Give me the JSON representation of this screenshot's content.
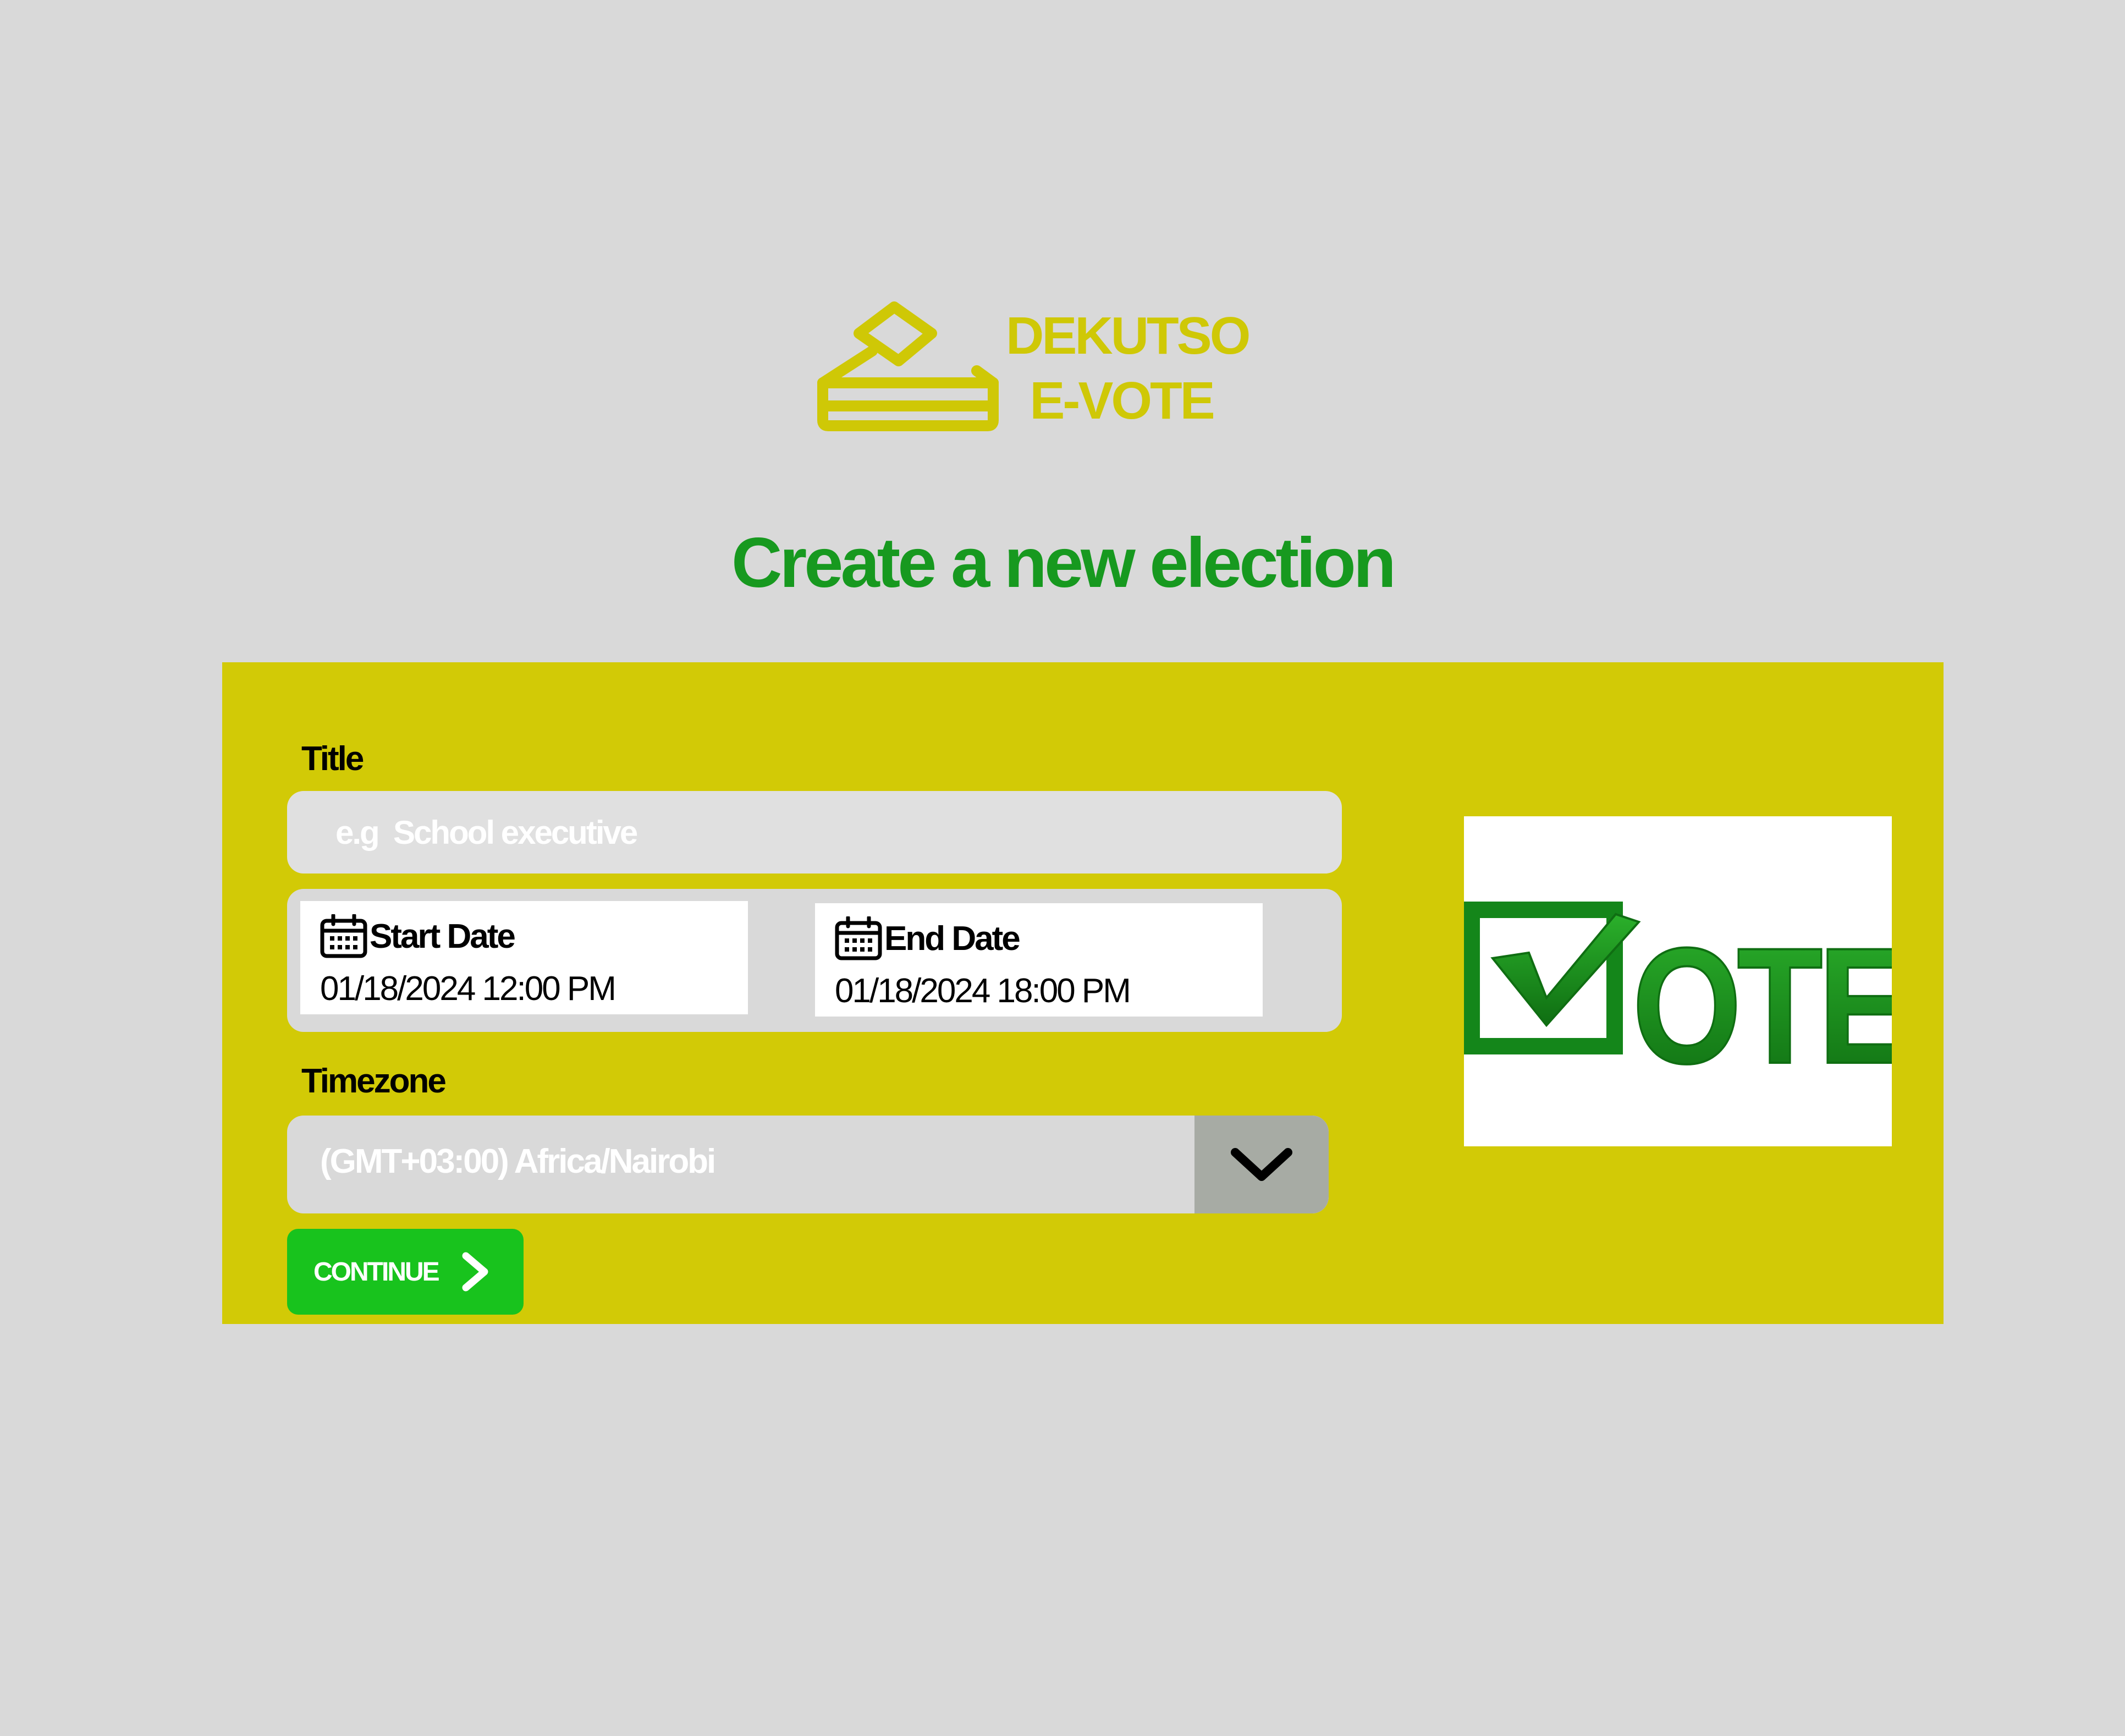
{
  "brand": {
    "logo_icon": "ballot-box-icon",
    "name_line1": "DEKUTSO",
    "name_line2": "E-VOTE",
    "color": "#cfc806"
  },
  "page": {
    "title": "Create a new election",
    "title_color": "#17991f",
    "background": "#d9d9d9"
  },
  "form": {
    "panel_color": "#d2ca06",
    "title_label": "Title",
    "title_placeholder": "e.g  School executive",
    "title_value": "",
    "start_date": {
      "label": "Start Date",
      "icon": "calendar-icon",
      "value": "01/18/2024 12:00 PM"
    },
    "end_date": {
      "label": "End Date",
      "icon": "calendar-icon",
      "value": "01/18/2024 18:00 PM"
    },
    "timezone_label": "Timezone",
    "timezone_value": "(GMT+03:00)  Africa/Nairobi",
    "timezone_toggle_icon": "chevron-down-icon",
    "continue_label": "CONTINUE",
    "continue_icon": "chevron-right-icon",
    "continue_color": "#18c31d"
  },
  "illustration": {
    "word": "OTE",
    "icon": "checkbox-check-icon",
    "color": "#1a8a1c"
  }
}
